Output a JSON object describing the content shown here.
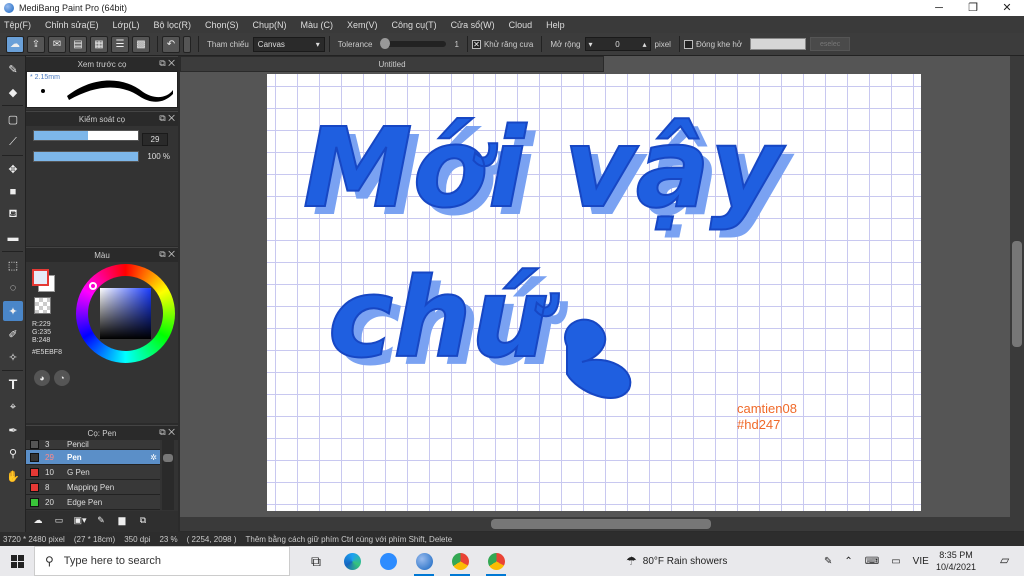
{
  "window": {
    "title": "MediBang Paint Pro (64bit)",
    "minimize": "─",
    "maximize": "❐",
    "close": "✕"
  },
  "menu": [
    "Tệp(F)",
    "Chỉnh sửa(E)",
    "Lớp(L)",
    "Bộ lọc(R)",
    "Chọn(S)",
    "Chụp(N)",
    "Màu (C)",
    "Xem(V)",
    "Công cụ(T)",
    "Cửa sổ(W)",
    "Cloud",
    "Help"
  ],
  "toolbar": {
    "reference_label": "Tham chiếu",
    "reference_value": "Canvas",
    "tolerance_label": "Tolerance",
    "tolerance_value": "1",
    "antialias_label": "Khử răng cưa",
    "antialias_checked": "✕",
    "expand_label": "Mở rộng",
    "expand_value": "0",
    "expand_unit": "pixel",
    "gap_label": "Đóng khe hở",
    "deselect_label": "eselec"
  },
  "brush_preview": {
    "title": "Xem trước cọ",
    "size": "* 2.15mm"
  },
  "brush_control": {
    "title": "Kiểm soát cọ",
    "size_value": "29",
    "size_fill": 0.52,
    "opacity_value": "100 %",
    "opacity_fill": 1.0
  },
  "color_panel": {
    "title": "Màu",
    "r": "R:229",
    "g": "G:235",
    "b": "B:248",
    "hex": "#E5EBF8"
  },
  "brush_list": {
    "title": "Cọ: Pen",
    "items": [
      {
        "num": "3",
        "name": "Pencil",
        "color": "#555555"
      },
      {
        "num": "29",
        "name": "Pen",
        "color": "#333333"
      },
      {
        "num": "10",
        "name": "G Pen",
        "color": "#e53935"
      },
      {
        "num": "8",
        "name": "Mapping Pen",
        "color": "#e53935"
      },
      {
        "num": "20",
        "name": "Edge Pen",
        "color": "#39c439"
      }
    ]
  },
  "document": {
    "tab": "Untitled",
    "lettering_line1": "Mới vậy",
    "lettering_line2": "chứ ",
    "signature_line1": "camtien08",
    "signature_line2": "#hd247"
  },
  "status": {
    "size": "3720 * 2480 pixel",
    "physical": "(27 * 18cm)",
    "dpi": "350 dpi",
    "zoom": "23 %",
    "cursor": "( 2254, 2098 )",
    "hint": "Thêm bằng cách giữ phím Ctrl cùng với phím Shift, Delete"
  },
  "taskbar": {
    "search_placeholder": "Type here to search",
    "weather": "80°F  Rain showers",
    "lang": "VIE",
    "time": "8:35 PM",
    "date": "10/4/2021"
  }
}
